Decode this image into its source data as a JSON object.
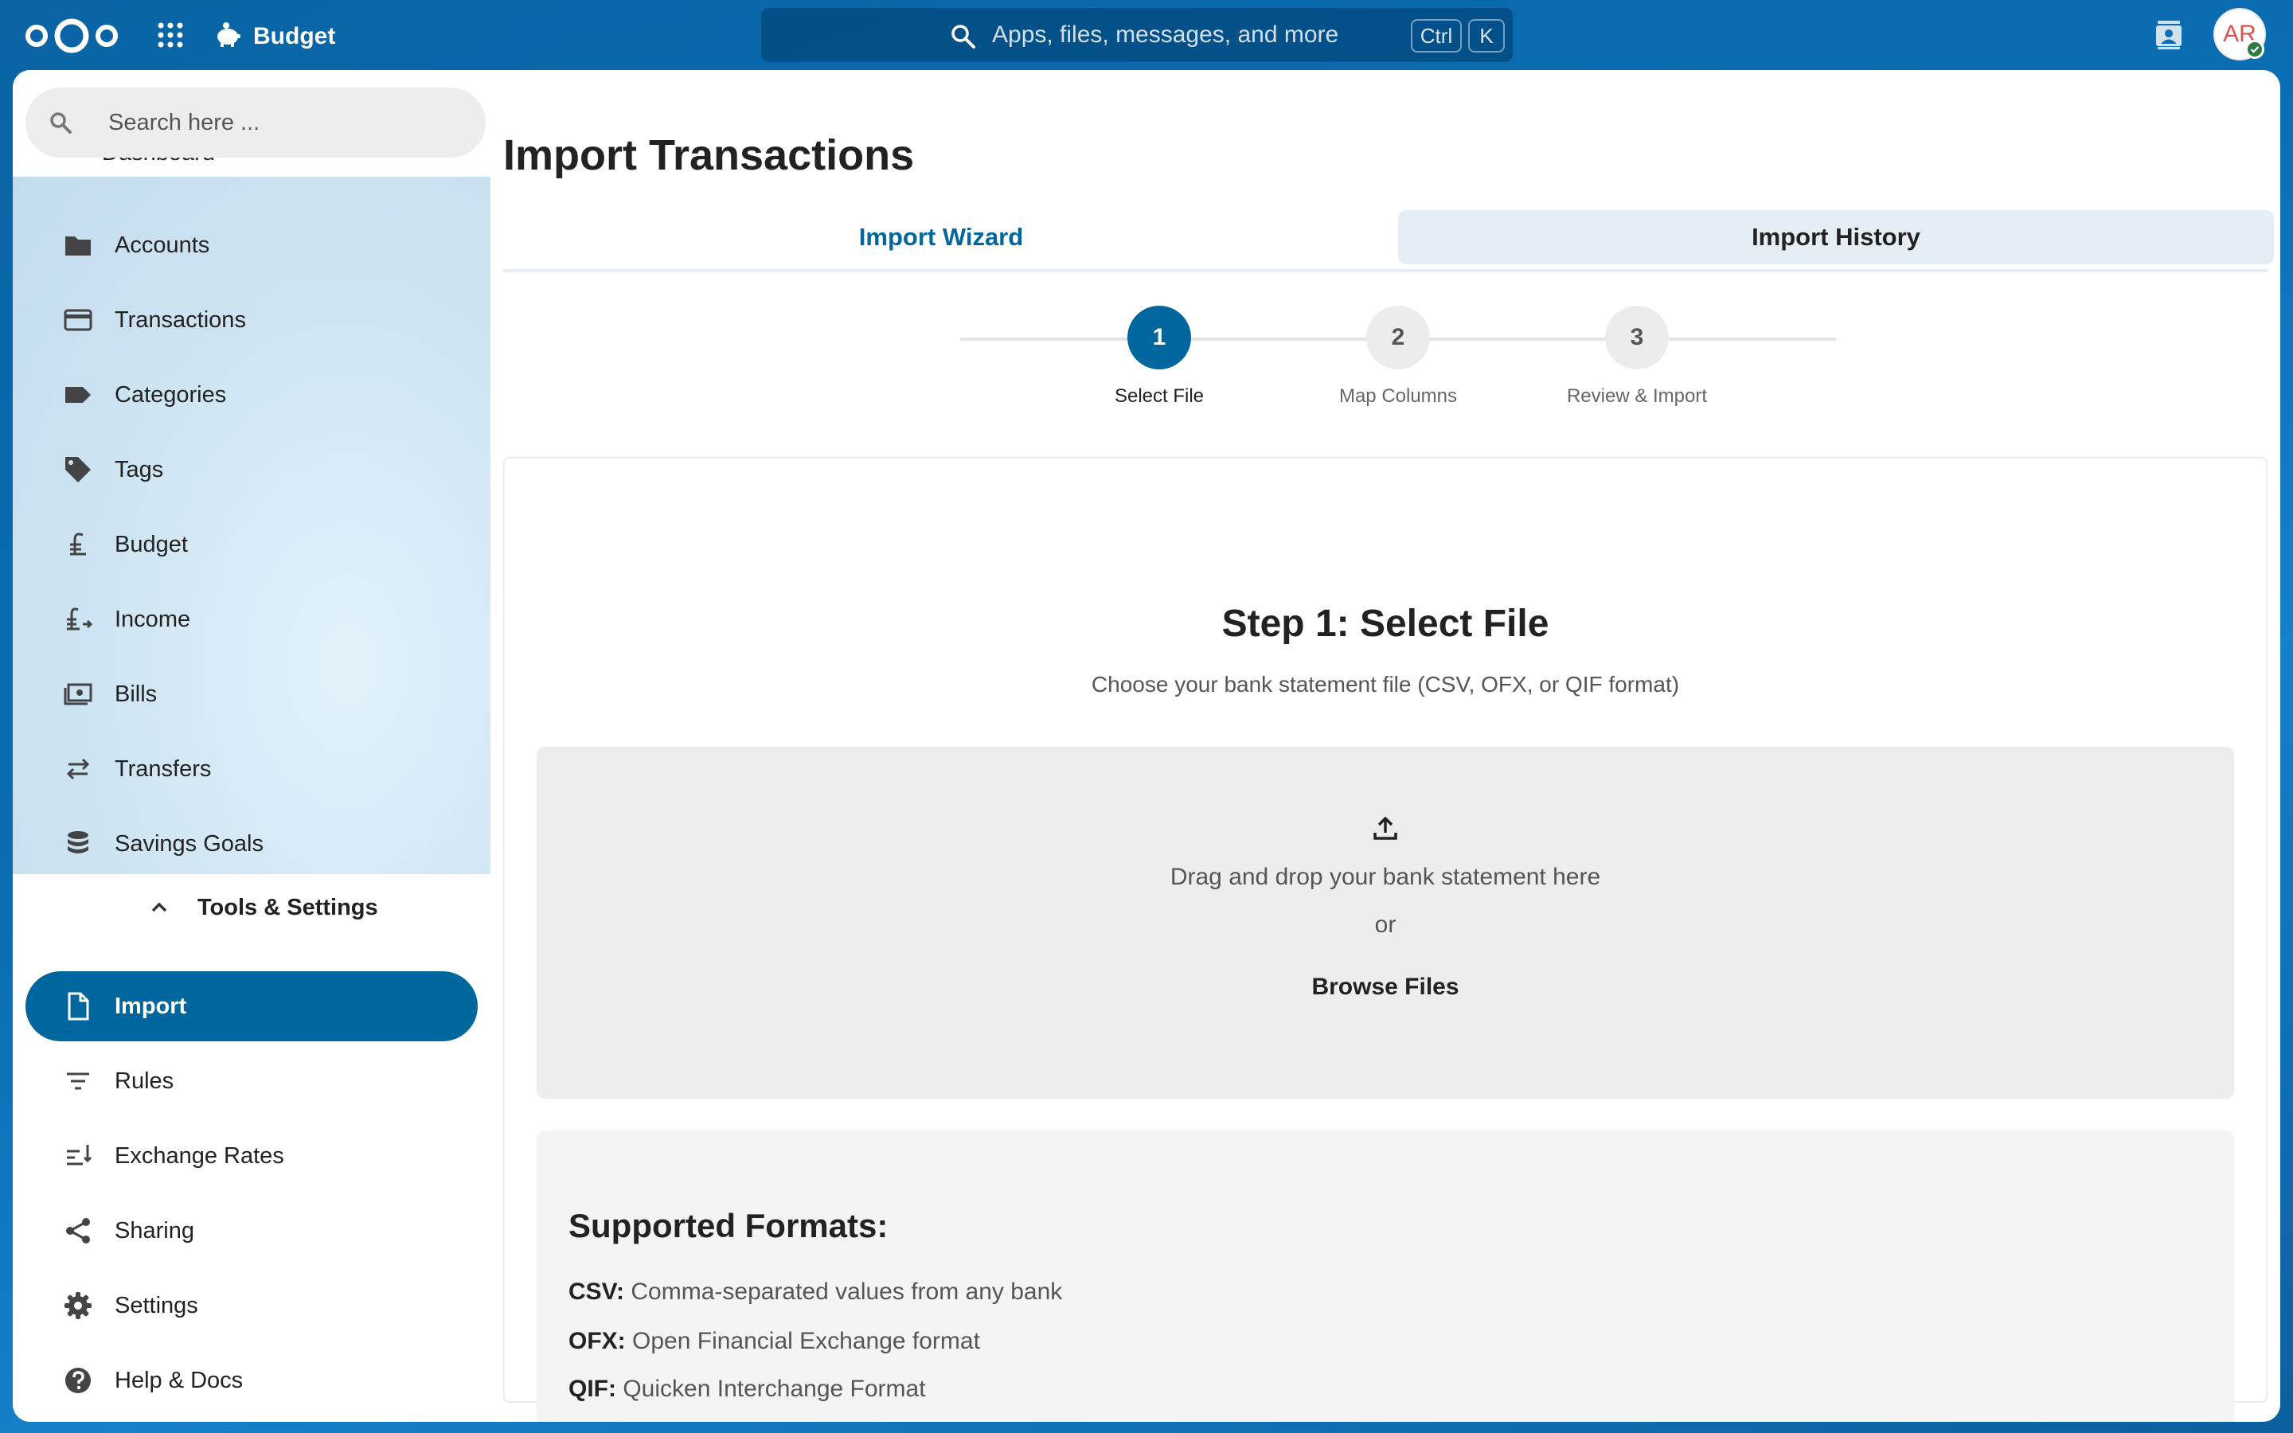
{
  "header": {
    "app_name": "Budget",
    "search_placeholder": "Apps, files, messages, and more",
    "shortcut_ctrl": "Ctrl",
    "shortcut_key": "K",
    "avatar_initials": "AR"
  },
  "sidebar": {
    "search_placeholder": "Search here ...",
    "clipped_item": "Dashboard",
    "items": [
      {
        "label": "Accounts",
        "icon": "folder-icon"
      },
      {
        "label": "Transactions",
        "icon": "credit-card-icon"
      },
      {
        "label": "Categories",
        "icon": "label-icon"
      },
      {
        "label": "Tags",
        "icon": "tag-icon"
      },
      {
        "label": "Budget",
        "icon": "currency-icon"
      },
      {
        "label": "Income",
        "icon": "currency-plus-icon"
      },
      {
        "label": "Bills",
        "icon": "cash-icon"
      },
      {
        "label": "Transfers",
        "icon": "swap-icon"
      },
      {
        "label": "Savings Goals",
        "icon": "database-icon"
      }
    ],
    "section_header": "Tools & Settings",
    "tools": [
      {
        "label": "Import",
        "icon": "file-icon",
        "active": true
      },
      {
        "label": "Rules",
        "icon": "filter-icon"
      },
      {
        "label": "Exchange Rates",
        "icon": "exchange-icon"
      },
      {
        "label": "Sharing",
        "icon": "share-icon"
      },
      {
        "label": "Settings",
        "icon": "gear-icon"
      },
      {
        "label": "Help & Docs",
        "icon": "help-icon"
      }
    ],
    "accent_color": "#00679e"
  },
  "main": {
    "title": "Import Transactions",
    "tabs": [
      {
        "label": "Import Wizard",
        "active": true
      },
      {
        "label": "Import History",
        "active": false
      }
    ],
    "steps": [
      {
        "number": "1",
        "label": "Select File",
        "active": true
      },
      {
        "number": "2",
        "label": "Map Columns",
        "active": false
      },
      {
        "number": "3",
        "label": "Review & Import",
        "active": false
      }
    ],
    "step_title": "Step 1: Select File",
    "step_subtitle": "Choose your bank statement file (CSV, OFX, or QIF format)",
    "dropzone": {
      "text": "Drag and drop your bank statement here",
      "or": "or",
      "browse_label": "Browse Files"
    },
    "formats": {
      "title": "Supported Formats:",
      "items": [
        {
          "name": "CSV:",
          "description": "Comma-separated values from any bank"
        },
        {
          "name": "OFX:",
          "description": "Open Financial Exchange format"
        },
        {
          "name": "QIF:",
          "description": "Quicken Interchange Format"
        }
      ]
    }
  }
}
